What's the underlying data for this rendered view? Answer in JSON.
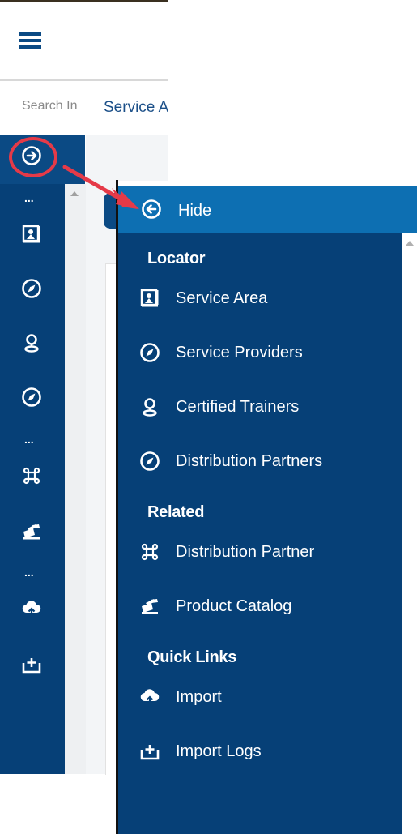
{
  "header": {
    "menu_icon": "hamburger-icon",
    "search_label": "Search In",
    "service_tab_label": "Service A"
  },
  "rail": {
    "toggle_icon": "arrow-right-circle-icon",
    "more_label": "...",
    "icons": [
      "service-area-icon",
      "compass-icon",
      "location-pin-icon",
      "compass-icon",
      "command-icon",
      "product-catalog-icon",
      "cloud-upload-icon",
      "import-logs-icon"
    ]
  },
  "panel": {
    "hide_label": "Hide",
    "hide_icon": "arrow-left-circle-icon",
    "sections": [
      {
        "title": "Locator",
        "items": [
          {
            "label": "Service Area",
            "icon": "service-area-icon"
          },
          {
            "label": "Service Providers",
            "icon": "compass-icon"
          },
          {
            "label": "Certified Trainers",
            "icon": "location-pin-icon"
          },
          {
            "label": "Distribution Partners",
            "icon": "compass-icon"
          }
        ]
      },
      {
        "title": "Related",
        "items": [
          {
            "label": "Distribution Partner",
            "icon": "command-icon"
          },
          {
            "label": "Product Catalog",
            "icon": "product-catalog-icon"
          }
        ]
      },
      {
        "title": "Quick Links",
        "items": [
          {
            "label": "Import",
            "icon": "cloud-upload-icon"
          },
          {
            "label": "Import Logs",
            "icon": "import-logs-icon"
          }
        ]
      }
    ]
  },
  "colors": {
    "nav_dark": "#064077",
    "nav_header": "#0d6fb2",
    "highlight": "#e53a48"
  }
}
